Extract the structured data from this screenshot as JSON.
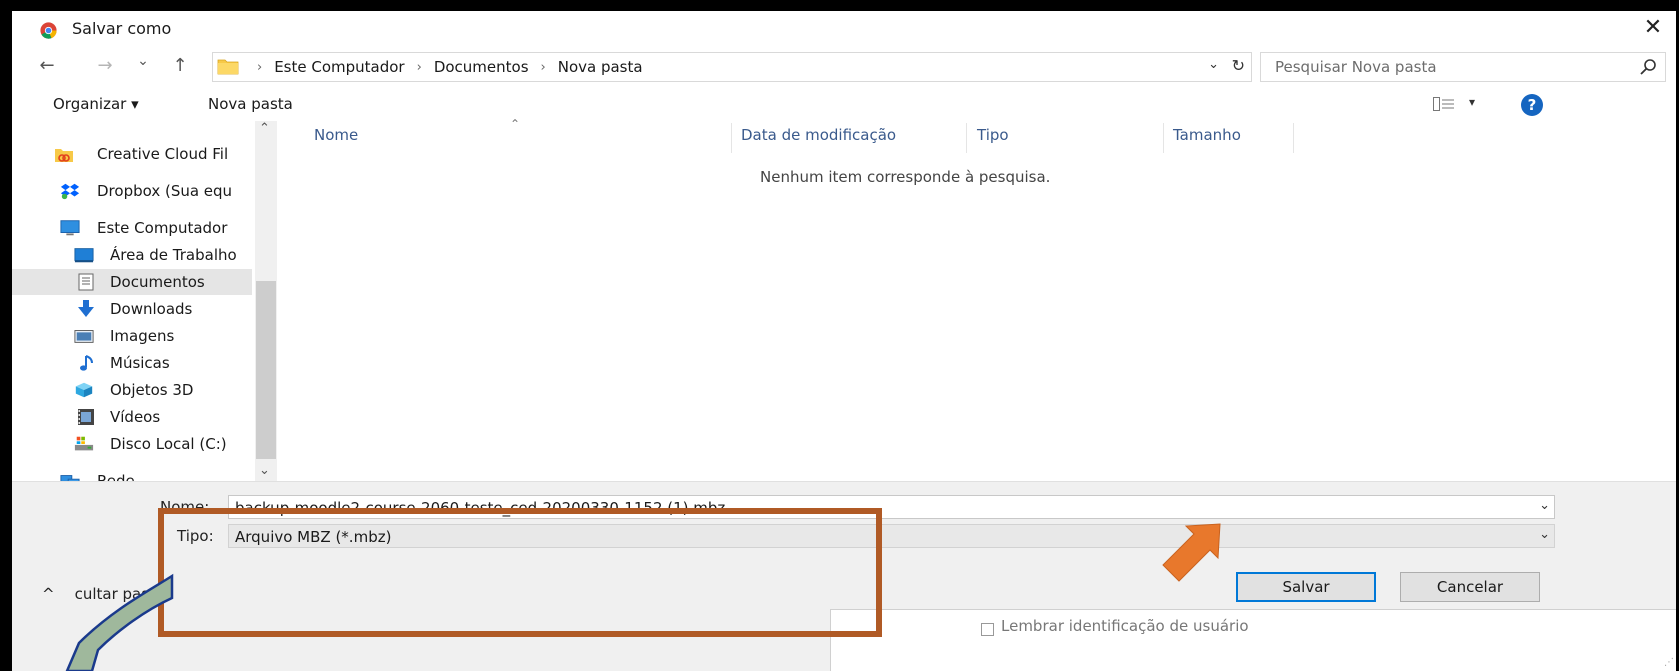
{
  "window": {
    "title": "Salvar como",
    "close_glyph": "✕"
  },
  "navigation": {
    "back_glyph": "←",
    "forward_glyph": "→",
    "recent_glyph": "⌄",
    "up_glyph": "↑",
    "breadcrumbs": [
      "Este Computador",
      "Documentos",
      "Nova pasta"
    ],
    "breadcrumb_separator": "›",
    "dropdown_glyph": "⌄",
    "refresh_glyph": "↻",
    "search_placeholder": "Pesquisar Nova pasta"
  },
  "toolbar": {
    "organize_label": "Organizar ▾",
    "new_folder_label": "Nova pasta",
    "view_arrow": "▾",
    "help_label": "?"
  },
  "sidebar": {
    "items": [
      {
        "label": "Creative Cloud Fil",
        "icon": "creative-cloud-icon"
      },
      {
        "label": "Dropbox (Sua equ",
        "icon": "dropbox-icon"
      },
      {
        "label": "Este Computador",
        "icon": "computer-icon"
      },
      {
        "label": "Área de Trabalho",
        "icon": "desktop-icon"
      },
      {
        "label": "Documentos",
        "icon": "documents-icon",
        "selected": true
      },
      {
        "label": "Downloads",
        "icon": "downloads-icon"
      },
      {
        "label": "Imagens",
        "icon": "pictures-icon"
      },
      {
        "label": "Músicas",
        "icon": "music-icon"
      },
      {
        "label": "Objetos 3D",
        "icon": "objects-3d-icon"
      },
      {
        "label": "Vídeos",
        "icon": "videos-icon"
      },
      {
        "label": "Disco Local (C:)",
        "icon": "local-disk-icon"
      },
      {
        "label": "Rede",
        "icon": "network-icon"
      }
    ],
    "scroll_up_glyph": "⌃",
    "scroll_down_glyph": "⌄"
  },
  "file_list": {
    "columns": [
      "Nome",
      "Data de modificação",
      "Tipo",
      "Tamanho"
    ],
    "sort_indicator": "⌃",
    "empty_message": "Nenhum item corresponde à pesquisa."
  },
  "save_form": {
    "name_label": "Nome:",
    "name_value": "backup-moodle2-course-2060-teste_ced-20200330-1152 (1).mbz",
    "type_label": "Tipo:",
    "type_value": "Arquivo MBZ (*.mbz)",
    "chevron": "⌄",
    "hide_folders_chevron": "^",
    "hide_folders_label": "cultar pastas",
    "save_button": "Salvar",
    "cancel_button": "Cancelar"
  },
  "background_page": {
    "remember_label": "Lembrar identificação de usuário"
  },
  "colors": {
    "annotation_box": "#b05a25",
    "annotation_arrow": "#e8782c",
    "callout_fill": "#9fb89c",
    "callout_outline": "#1a3a8c",
    "save_button_border": "#0078d7",
    "help_icon": "#1565c0"
  }
}
